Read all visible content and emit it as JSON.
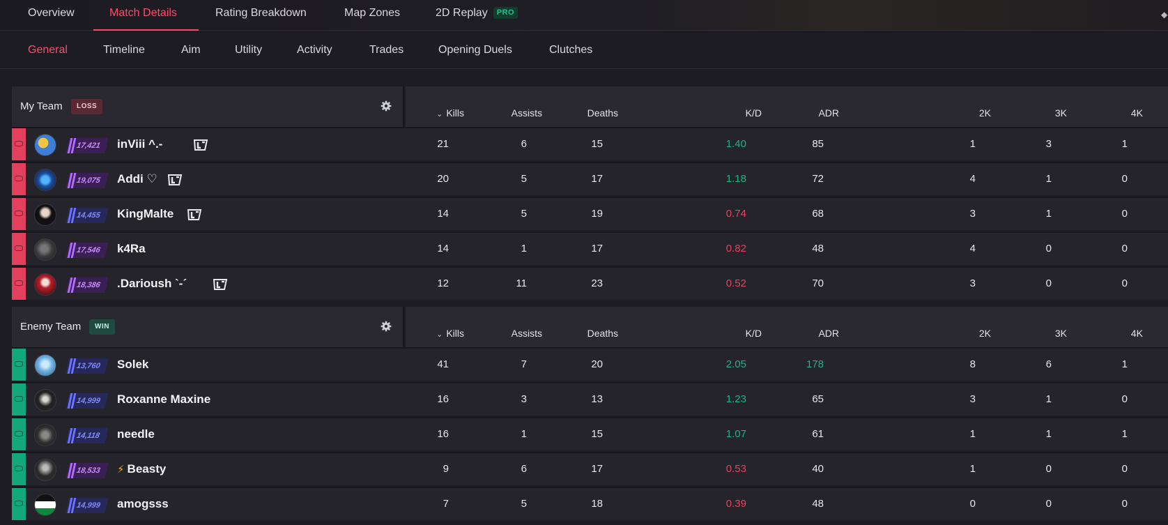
{
  "top_nav": {
    "tabs": [
      {
        "label": "Overview"
      },
      {
        "label": "Match Details"
      },
      {
        "label": "Rating Breakdown"
      },
      {
        "label": "Map Zones"
      },
      {
        "label": "2D Replay"
      }
    ],
    "active": "Match Details",
    "pro_badge": "PRO"
  },
  "sub_nav": {
    "tabs": [
      {
        "label": "General"
      },
      {
        "label": "Timeline"
      },
      {
        "label": "Aim"
      },
      {
        "label": "Utility"
      },
      {
        "label": "Activity"
      },
      {
        "label": "Trades"
      },
      {
        "label": "Opening Duels"
      },
      {
        "label": "Clutches"
      }
    ],
    "active": "General"
  },
  "columns": {
    "kills": "Kills",
    "assists": "Assists",
    "deaths": "Deaths",
    "kd": "K/D",
    "adr": "ADR",
    "k2": "2K",
    "k3": "3K",
    "k4": "4K",
    "sort_icon": "chevron-down-icon"
  },
  "colors": {
    "accent": "#ff4a6e",
    "my_team": "#e3405d",
    "enemy_team": "#13a879",
    "good_stat": "#1bb486",
    "bad_stat": "#e8405f"
  },
  "my_team": {
    "name": "My Team",
    "result": "LOSS",
    "players": [
      {
        "name": "inViii ^.-",
        "rating": "17,421",
        "rating_tier": "purple",
        "has_brand": true,
        "kills": "21",
        "assists": "6",
        "deaths": "15",
        "kd": "1.40",
        "kd_status": "good",
        "adr": "85",
        "adr_status": "normal",
        "k2": "1",
        "k3": "3",
        "k4": "1"
      },
      {
        "name": "Addi ♡",
        "rating": "19,075",
        "rating_tier": "purple",
        "has_brand": true,
        "kills": "20",
        "assists": "5",
        "deaths": "17",
        "kd": "1.18",
        "kd_status": "good",
        "adr": "72",
        "adr_status": "normal",
        "k2": "4",
        "k3": "1",
        "k4": "0"
      },
      {
        "name": "KingMalte",
        "rating": "14,455",
        "rating_tier": "blue",
        "has_brand": true,
        "kills": "14",
        "assists": "5",
        "deaths": "19",
        "kd": "0.74",
        "kd_status": "bad",
        "adr": "68",
        "adr_status": "normal",
        "k2": "3",
        "k3": "1",
        "k4": "0"
      },
      {
        "name": "k4Ra",
        "rating": "17,546",
        "rating_tier": "purple",
        "has_brand": false,
        "kills": "14",
        "assists": "1",
        "deaths": "17",
        "kd": "0.82",
        "kd_status": "bad",
        "adr": "48",
        "adr_status": "normal",
        "k2": "4",
        "k3": "0",
        "k4": "0"
      },
      {
        "name": ".Darioush `-´",
        "rating": "18,386",
        "rating_tier": "purple",
        "has_brand": true,
        "kills": "12",
        "assists": "11",
        "deaths": "23",
        "kd": "0.52",
        "kd_status": "bad",
        "adr": "70",
        "adr_status": "normal",
        "k2": "3",
        "k3": "0",
        "k4": "0"
      }
    ]
  },
  "enemy_team": {
    "name": "Enemy Team",
    "result": "WIN",
    "players": [
      {
        "name": "Solek",
        "rating": "13,760",
        "rating_tier": "blue",
        "has_brand": false,
        "kills": "41",
        "assists": "7",
        "deaths": "20",
        "kd": "2.05",
        "kd_status": "good",
        "adr": "178",
        "adr_status": "good",
        "k2": "8",
        "k3": "6",
        "k4": "1"
      },
      {
        "name": "Roxanne Maxine",
        "rating": "14,999",
        "rating_tier": "blue",
        "has_brand": false,
        "kills": "16",
        "assists": "3",
        "deaths": "13",
        "kd": "1.23",
        "kd_status": "good",
        "adr": "65",
        "adr_status": "normal",
        "k2": "3",
        "k3": "1",
        "k4": "0"
      },
      {
        "name": "needle",
        "rating": "14,118",
        "rating_tier": "blue",
        "has_brand": false,
        "kills": "16",
        "assists": "1",
        "deaths": "15",
        "kd": "1.07",
        "kd_status": "good",
        "adr": "61",
        "adr_status": "normal",
        "k2": "1",
        "k3": "1",
        "k4": "1"
      },
      {
        "name": "Beasty",
        "rating": "18,533",
        "rating_tier": "purple",
        "has_brand": false,
        "bolt": true,
        "kills": "9",
        "assists": "6",
        "deaths": "17",
        "kd": "0.53",
        "kd_status": "bad",
        "adr": "40",
        "adr_status": "normal",
        "k2": "1",
        "k3": "0",
        "k4": "0"
      },
      {
        "name": "amogsss",
        "rating": "14,999",
        "rating_tier": "blue",
        "has_brand": false,
        "kills": "7",
        "assists": "5",
        "deaths": "18",
        "kd": "0.39",
        "kd_status": "bad",
        "adr": "48",
        "adr_status": "normal",
        "k2": "0",
        "k3": "0",
        "k4": "0"
      }
    ]
  }
}
